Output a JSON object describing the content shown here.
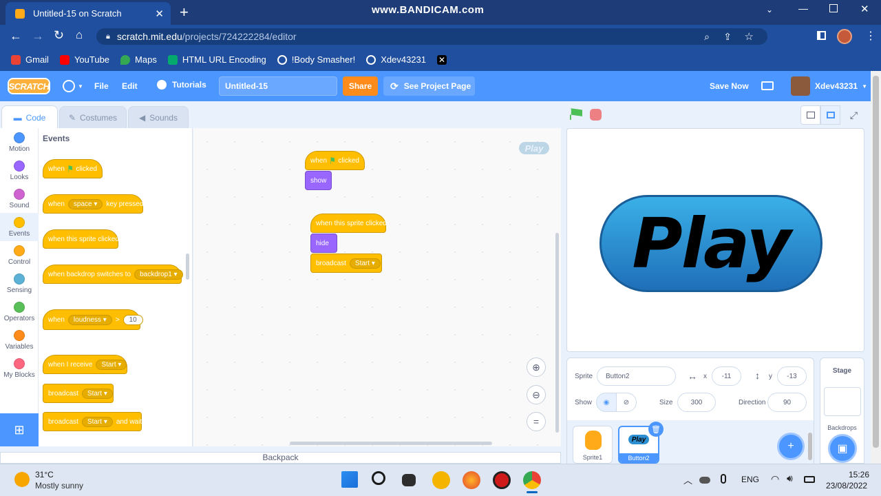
{
  "browser": {
    "tab_title": "Untitled-15 on Scratch",
    "watermark": "www.BANDICAM.com",
    "url_domain": "scratch.mit.edu",
    "url_path": "/projects/724222284/editor",
    "bookmarks": [
      "Gmail",
      "YouTube",
      "Maps",
      "HTML URL Encoding",
      "!Body Smasher!",
      "Xdev43231"
    ]
  },
  "menu": {
    "logo": "SCRATCH",
    "file": "File",
    "edit": "Edit",
    "tutorials": "Tutorials",
    "project_title": "Untitled-15",
    "share": "Share",
    "see_project_page": "See Project Page",
    "save_now": "Save Now",
    "username": "Xdev43231"
  },
  "tabs": {
    "code": "Code",
    "costumes": "Costumes",
    "sounds": "Sounds"
  },
  "categories": [
    {
      "label": "Motion",
      "color": "#4c97ff"
    },
    {
      "label": "Looks",
      "color": "#9966ff"
    },
    {
      "label": "Sound",
      "color": "#cf63cf"
    },
    {
      "label": "Events",
      "color": "#ffbf00"
    },
    {
      "label": "Control",
      "color": "#ffab19"
    },
    {
      "label": "Sensing",
      "color": "#5cb1d6"
    },
    {
      "label": "Operators",
      "color": "#59c059"
    },
    {
      "label": "Variables",
      "color": "#ff8c1a"
    },
    {
      "label": "My Blocks",
      "color": "#ff6680"
    }
  ],
  "palette": {
    "heading": "Events",
    "when": "when",
    "clicked": "clicked",
    "space": "space",
    "key_pressed": "key pressed",
    "when_this_sprite_clicked": "when this sprite clicked",
    "when_backdrop_switches_to": "when backdrop switches to",
    "backdrop1": "backdrop1",
    "loudness": "loudness",
    "gt": ">",
    "ten": "10",
    "when_i_receive": "when I receive",
    "start": "Start",
    "broadcast": "broadcast",
    "and_wait": "and wait"
  },
  "scripts": {
    "when": "when",
    "clicked": "clicked",
    "show": "show",
    "when_this_sprite_clicked": "when this sprite clicked",
    "hide": "hide",
    "broadcast": "broadcast",
    "start": "Start",
    "thumb_label": "Play"
  },
  "backpack": "Backpack",
  "stage": {
    "button_text": "Play"
  },
  "sprite_info": {
    "sprite_label": "Sprite",
    "sprite_name": "Button2",
    "x_label": "x",
    "x_value": "-11",
    "y_label": "y",
    "y_value": "-13",
    "show_label": "Show",
    "size_label": "Size",
    "size_value": "300",
    "direction_label": "Direction",
    "direction_value": "90"
  },
  "sprites": [
    {
      "name": "Sprite1"
    },
    {
      "name": "Button2",
      "thumb": "Play"
    }
  ],
  "stage_col": {
    "title": "Stage",
    "backdrops": "Backdrops"
  },
  "taskbar": {
    "temp": "31°C",
    "weather": "Mostly sunny",
    "lang": "ENG",
    "time": "15:26",
    "date": "23/08/2022"
  }
}
